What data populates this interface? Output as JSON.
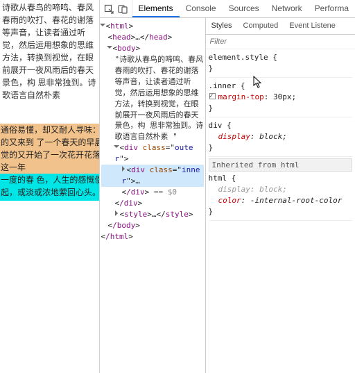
{
  "page": {
    "para1": "诗歌从春鸟的啼鸣、春风春雨的吹打、春花的谢落等声音，让读者通过听觉，然后运用想象的思维方法，转换到视觉，在眼前展开一夜风雨后的春天景色，构 思非常独到。诗歌语言自然朴素",
    "innerText": "通俗易懂，却又耐人寻味：不知不觉的又来到 了一个春天的早晨，不知不觉的又开始了一次花开花落。思想着这一年",
    "restText": "一度的春 色，人生的感慨便会油然而起，或淡或浓地萦回心头。"
  },
  "devtools": {
    "tabs": [
      "Elements",
      "Console",
      "Sources",
      "Network",
      "Performa"
    ],
    "activeTab": 0,
    "elements": {
      "root_open": "html",
      "head": "head",
      "body": "body",
      "textNode": "\"诗歌从春鸟的啼鸣、春风春雨的吹打、春花的谢落等声音，让读者通过听觉，然后运用想象的思维方法，转换到视觉，在眼前展开一夜风雨后的春天景色，构 思非常独到。诗歌语言自然朴素 \"",
      "outerTag": "div",
      "outerClass": "outer",
      "innerTag": "div",
      "innerClass": "inner",
      "closeDiv": "/div",
      "selectedHint": "== $0",
      "style": "style",
      "closeBody": "/body",
      "closeHtml": "/html"
    },
    "stylesTabs": [
      "Styles",
      "Computed",
      "Event Listene"
    ],
    "filterPlaceholder": "Filter",
    "rules": {
      "elementStyle": {
        "selector": "element.style",
        "props": []
      },
      "inner": {
        "selector": ".inner",
        "props": [
          {
            "name": "margin-top",
            "value": "30px",
            "checked": true
          }
        ]
      },
      "div": {
        "selector": "div",
        "props": [
          {
            "name": "display",
            "value": "block",
            "italic": true
          }
        ]
      },
      "inheritedLabel": "Inherited from",
      "inheritedFrom": "html",
      "htmlRule": {
        "selector": "html",
        "props": [
          {
            "name": "display",
            "value": "block",
            "disabled": true,
            "italic": true
          },
          {
            "name": "color",
            "value": "-internal-root-color",
            "italic": true
          }
        ]
      }
    }
  }
}
